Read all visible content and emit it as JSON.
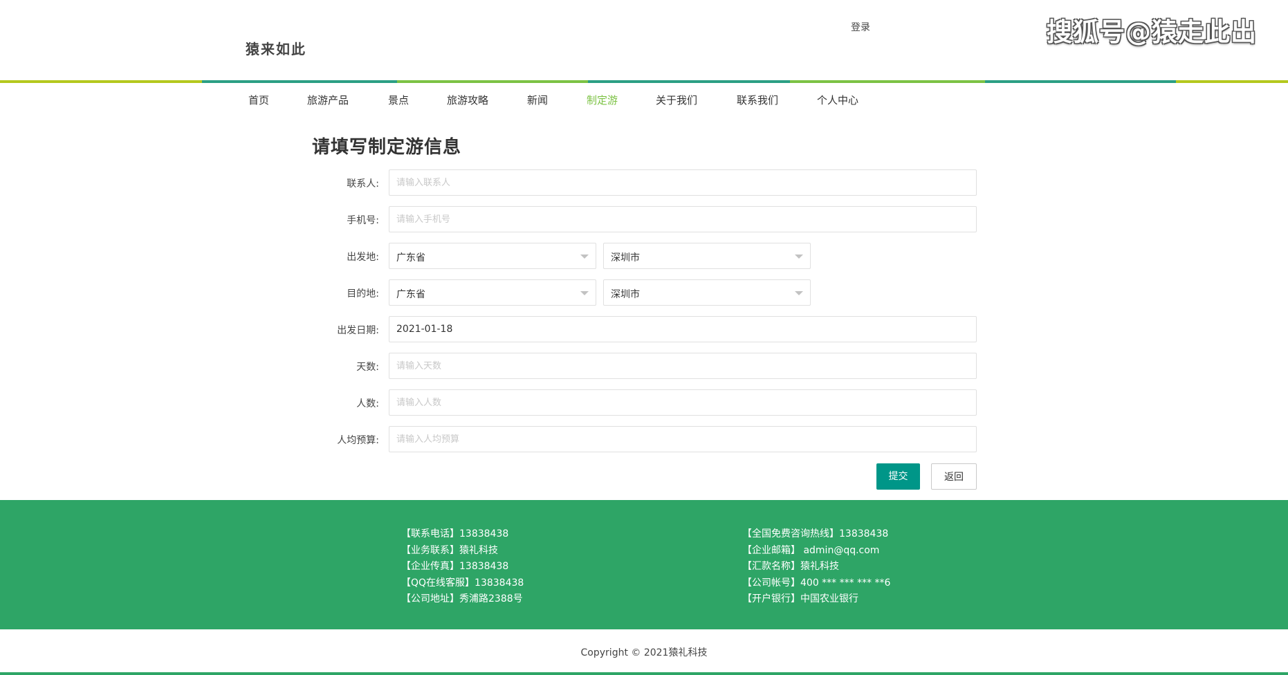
{
  "header": {
    "logo_text": "猿来如此",
    "login_label": "登录",
    "watermark": "搜狐号@猿走此出"
  },
  "colors": {
    "accent_green": "#7cc244",
    "teal": "#2b9f84",
    "lime": "#b4c81e",
    "submit_bg": "#009688",
    "footer_bg": "#2ea566"
  },
  "nav": {
    "items": [
      {
        "label": "首页"
      },
      {
        "label": "旅游产品"
      },
      {
        "label": "景点"
      },
      {
        "label": "旅游攻略"
      },
      {
        "label": "新闻"
      },
      {
        "label": "制定游"
      },
      {
        "label": "关于我们"
      },
      {
        "label": "联系我们"
      },
      {
        "label": "个人中心"
      }
    ],
    "active": "制定游"
  },
  "form": {
    "title": "请填写制定游信息",
    "contact_label": "联系人:",
    "contact_placeholder": "请输入联系人",
    "phone_label": "手机号:",
    "phone_placeholder": "请输入手机号",
    "departure_label": "出发地:",
    "departure_province": "广东省",
    "departure_city": "深圳市",
    "destination_label": "目的地:",
    "destination_province": "广东省",
    "destination_city": "深圳市",
    "date_label": "出发日期:",
    "date_value": "2021-01-18",
    "days_label": "天数:",
    "days_placeholder": "请输入天数",
    "people_label": "人数:",
    "people_placeholder": "请输入人数",
    "budget_label": "人均预算:",
    "budget_placeholder": "请输入人均预算",
    "submit_label": "提交",
    "back_label": "返回"
  },
  "footer": {
    "left": [
      "【联系电话】13838438",
      "【业务联系】猿礼科技",
      "【企业传真】13838438",
      "【QQ在线客服】13838438",
      "【公司地址】秀浦路2388号"
    ],
    "right": [
      "【全国免费咨询热线】13838438",
      "【企业邮箱】 admin@qq.com",
      "【汇款名称】猿礼科技",
      "【公司帐号】400 *** *** *** **6",
      "【开户银行】中国农业银行"
    ],
    "copyright": "Copyright © 2021猿礼科技"
  }
}
